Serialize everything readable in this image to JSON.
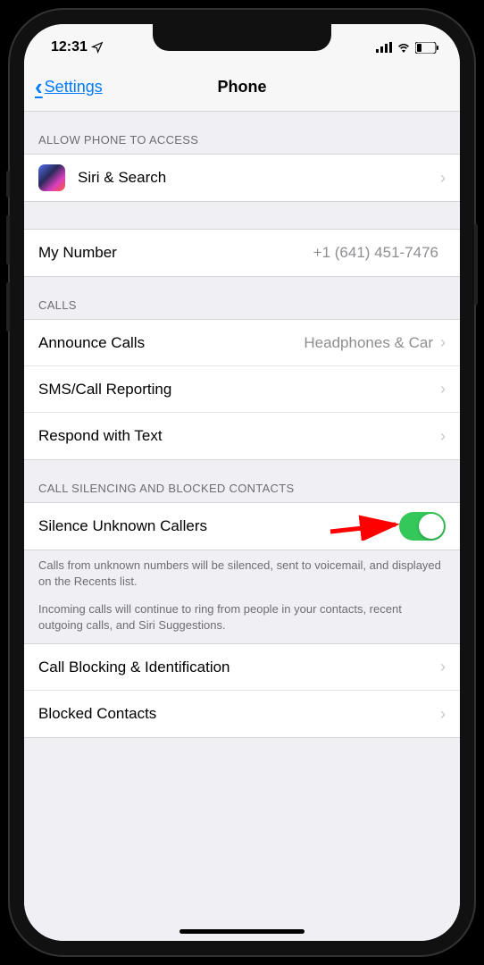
{
  "status_bar": {
    "time": "12:31",
    "location_icon": "location-arrow",
    "signal_icon": "cellular-signal",
    "wifi_icon": "wifi",
    "battery_icon": "battery-low"
  },
  "nav": {
    "back_label": "Settings",
    "title": "Phone"
  },
  "sections": {
    "access": {
      "header": "ALLOW PHONE TO ACCESS",
      "siri_label": "Siri & Search"
    },
    "my_number": {
      "label": "My Number",
      "value": "+1 (641) 451-7476"
    },
    "calls": {
      "header": "CALLS",
      "announce_label": "Announce Calls",
      "announce_value": "Headphones & Car",
      "sms_reporting_label": "SMS/Call Reporting",
      "respond_label": "Respond with Text"
    },
    "silencing": {
      "header": "CALL SILENCING AND BLOCKED CONTACTS",
      "silence_label": "Silence Unknown Callers",
      "silence_toggle": true,
      "footer1": "Calls from unknown numbers will be silenced, sent to voicemail, and displayed on the Recents list.",
      "footer2": "Incoming calls will continue to ring from people in your contacts, recent outgoing calls, and Siri Suggestions.",
      "call_blocking_label": "Call Blocking & Identification",
      "blocked_contacts_label": "Blocked Contacts"
    }
  },
  "annotation": {
    "arrow_color": "#ff0000"
  }
}
